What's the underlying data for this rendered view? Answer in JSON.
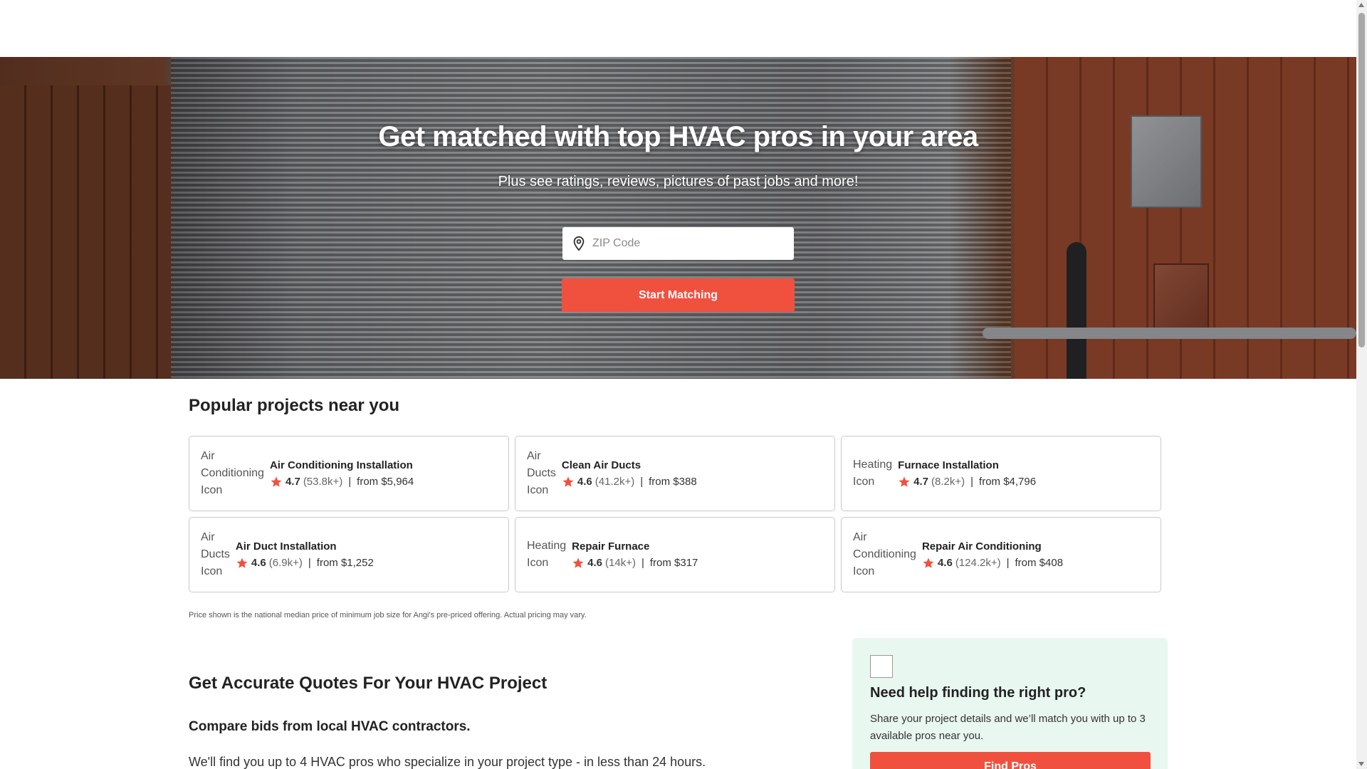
{
  "hero": {
    "title": "Get matched with top HVAC pros in your area",
    "subtitle": "Plus see ratings, reviews, pictures of past jobs and more!",
    "zip_placeholder": "ZIP Code",
    "start_button": "Start Matching"
  },
  "popular": {
    "title": "Popular projects near you",
    "cards": [
      {
        "icon_alt": "Air Conditioning Icon",
        "icon_lines": [
          "Air",
          "Conditioning",
          "Icon"
        ],
        "name": "Air Conditioning Installation",
        "rating": "4.7",
        "count": "(53.8k+)",
        "sep": "|",
        "price": "from $5,964"
      },
      {
        "icon_alt": "Air Ducts Icon",
        "icon_lines": [
          "Air",
          "Ducts",
          "Icon"
        ],
        "name": "Clean Air Ducts",
        "rating": "4.6",
        "count": "(41.2k+)",
        "sep": "|",
        "price": "from $388"
      },
      {
        "icon_alt": "Heating Icon",
        "icon_lines": [
          "Heating",
          "Icon"
        ],
        "name": "Furnace Installation",
        "rating": "4.7",
        "count": "(8.2k+)",
        "sep": "|",
        "price": "from $4,796"
      },
      {
        "icon_alt": "Air Ducts Icon",
        "icon_lines": [
          "Air",
          "Ducts",
          "Icon"
        ],
        "name": "Air Duct Installation",
        "rating": "4.6",
        "count": "(6.9k+)",
        "sep": "|",
        "price": "from $1,252"
      },
      {
        "icon_alt": "Heating Icon",
        "icon_lines": [
          "Heating",
          "Icon"
        ],
        "name": "Repair Furnace",
        "rating": "4.6",
        "count": "(14k+)",
        "sep": "|",
        "price": "from $317"
      },
      {
        "icon_alt": "Air Conditioning Icon",
        "icon_lines": [
          "Air",
          "Conditioning",
          "Icon"
        ],
        "name": "Repair Air Conditioning",
        "rating": "4.6",
        "count": "(124.2k+)",
        "sep": "|",
        "price": "from $408"
      }
    ],
    "disclaimer": "Price shown is the national median price of minimum job size for Angi's pre-priced offering. Actual pricing may vary."
  },
  "quotes": {
    "title": "Get Accurate Quotes For Your HVAC Project",
    "compare": "Compare bids from local HVAC contractors.",
    "find_text": "We'll find you up to 4 HVAC pros who specialize in your project type - in less than 24 hours."
  },
  "help": {
    "title": "Need help finding the right pro?",
    "text": "Share your project details and we’ll match you with up to 3 available pros near you.",
    "button": "Find Pros"
  },
  "colors": {
    "accent": "#f0513f",
    "star": "#f0513f",
    "help_bg": "#e8f7f0"
  }
}
